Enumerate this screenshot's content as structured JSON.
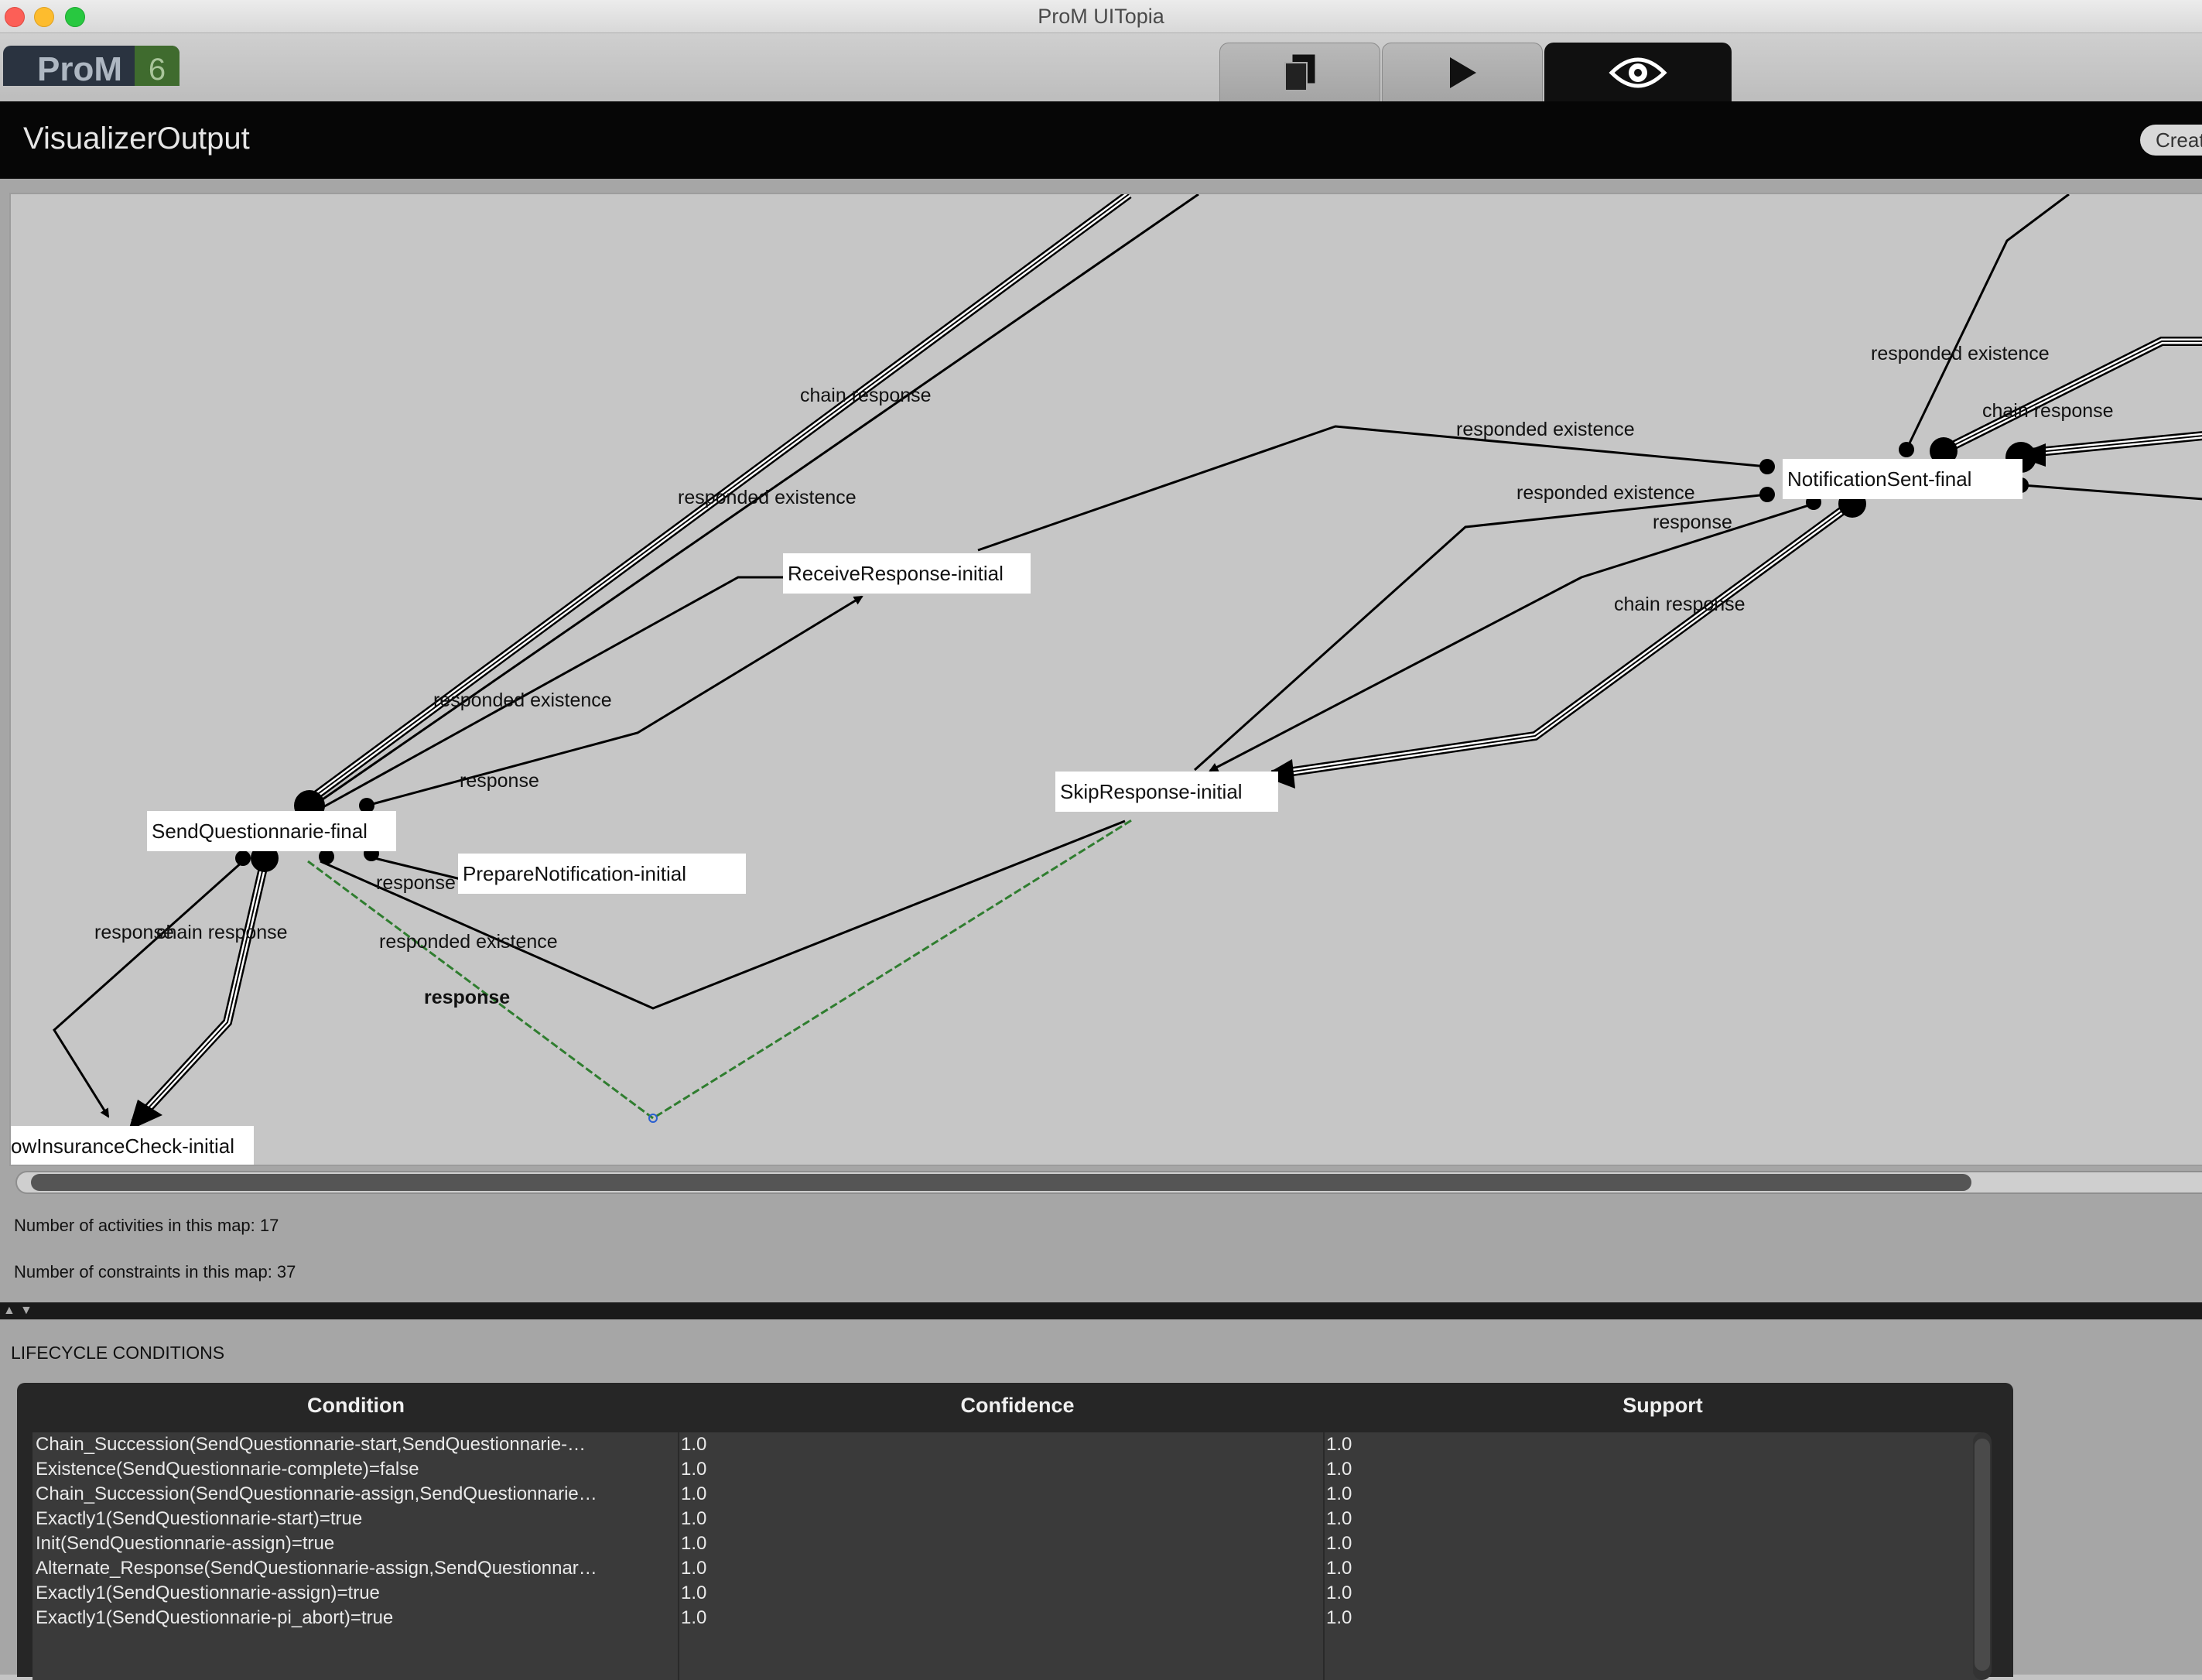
{
  "window": {
    "title": "ProM UITopia"
  },
  "toolbar": {
    "logo_text": "ProM",
    "logo_version": "6",
    "tabs": [
      {
        "icon": "workspace-icon",
        "active": false
      },
      {
        "icon": "play-icon",
        "active": false
      },
      {
        "icon": "eye-icon",
        "active": true
      }
    ]
  },
  "header": {
    "title": "VisualizerOutput",
    "create_button": "Creat"
  },
  "graph": {
    "nodes": [
      {
        "id": "send_q_final",
        "label": "SendQuestionnarie-final"
      },
      {
        "id": "receive_resp",
        "label": "ReceiveResponse-initial"
      },
      {
        "id": "prepare_notif",
        "label": "PrepareNotification-initial"
      },
      {
        "id": "skip_resp",
        "label": "SkipResponse-initial"
      },
      {
        "id": "notif_sent",
        "label": "NotificationSent-final"
      },
      {
        "id": "low_ins",
        "label": "owInsuranceCheck-initial"
      }
    ],
    "edge_labels": [
      "chain response",
      "responded existence",
      "responded existence",
      "response",
      "response",
      "responded existence",
      "response",
      "chain response",
      "response",
      "responded existence",
      "responded existence",
      "response",
      "chain response",
      "responded existence",
      "chain response"
    ]
  },
  "stats": {
    "activities": "Number of activities in this map: 17",
    "constraints": "Number of constraints in this map: 37"
  },
  "lifecycle": {
    "title": "LIFECYCLE CONDITIONS",
    "columns": [
      "Condition",
      "Confidence",
      "Support"
    ],
    "rows": [
      {
        "condition": "Chain_Succession(SendQuestionnarie-start,SendQuestionnarie-…",
        "confidence": "1.0",
        "support": "1.0"
      },
      {
        "condition": "Existence(SendQuestionnarie-complete)=false",
        "confidence": "1.0",
        "support": "1.0"
      },
      {
        "condition": "Chain_Succession(SendQuestionnarie-assign,SendQuestionnarie…",
        "confidence": "1.0",
        "support": "1.0"
      },
      {
        "condition": "Exactly1(SendQuestionnarie-start)=true",
        "confidence": "1.0",
        "support": "1.0"
      },
      {
        "condition": "Init(SendQuestionnarie-assign)=true",
        "confidence": "1.0",
        "support": "1.0"
      },
      {
        "condition": "Alternate_Response(SendQuestionnarie-assign,SendQuestionnar…",
        "confidence": "1.0",
        "support": "1.0"
      },
      {
        "condition": "Exactly1(SendQuestionnarie-assign)=true",
        "confidence": "1.0",
        "support": "1.0"
      },
      {
        "condition": "Exactly1(SendQuestionnarie-pi_abort)=true",
        "confidence": "1.0",
        "support": "1.0"
      }
    ]
  }
}
